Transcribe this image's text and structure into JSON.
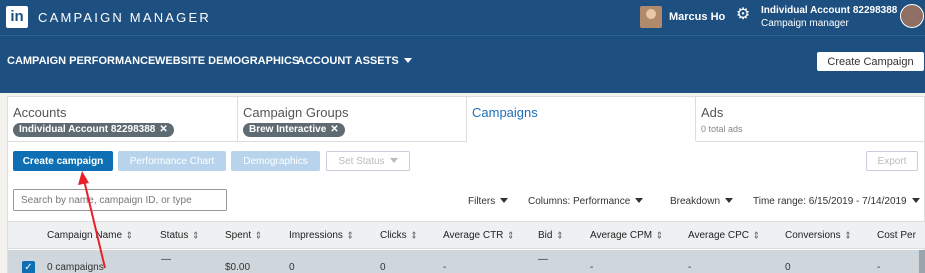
{
  "header": {
    "logo_text": "in",
    "app_title": "CAMPAIGN MANAGER",
    "user_name": "Marcus Ho",
    "account_name": "Individual Account 82298388",
    "account_role": "Campaign manager",
    "icons": [
      "linkedin-logo",
      "user-avatar",
      "gear-icon",
      "profile-avatar"
    ]
  },
  "nav": {
    "items": [
      "CAMPAIGN PERFORMANCE",
      "WEBSITE DEMOGRAPHICS",
      "ACCOUNT ASSETS"
    ],
    "create_label": "Create Campaign"
  },
  "tabs": {
    "accounts": {
      "label": "Accounts",
      "chip": "Individual Account 82298388"
    },
    "groups": {
      "label": "Campaign Groups",
      "chip": "Brew Interactive"
    },
    "campaigns": {
      "label": "Campaigns"
    },
    "ads": {
      "label": "Ads",
      "sub": "0 total ads"
    },
    "chip_close": "✕"
  },
  "actions": {
    "create": "Create campaign",
    "performance": "Performance Chart",
    "demographics": "Demographics",
    "set_status": "Set Status",
    "export": "Export"
  },
  "filters": {
    "search_placeholder": "Search by name, campaign ID, or type",
    "filters": "Filters",
    "columns": "Columns: Performance",
    "breakdown": "Breakdown",
    "time_range": "Time range: 6/15/2019 - 7/14/2019"
  },
  "table": {
    "columns": [
      "Campaign Name",
      "Status",
      "Spent",
      "Impressions",
      "Clicks",
      "Average CTR",
      "Bid",
      "Average CPM",
      "Average CPC",
      "Conversions",
      "Cost Per"
    ],
    "row": {
      "name": "0 campaigns",
      "status": "—",
      "spent": "$0.00",
      "impressions": "0",
      "clicks": "0",
      "ctr": "-",
      "bid": "—",
      "cpm": "-",
      "cpc": "-",
      "conversions": "0",
      "cost_per": "-"
    }
  },
  "colors": {
    "header_bg": "#1d4f80",
    "primary": "#0e6fb4",
    "annotation_arrow": "#e8202a"
  }
}
